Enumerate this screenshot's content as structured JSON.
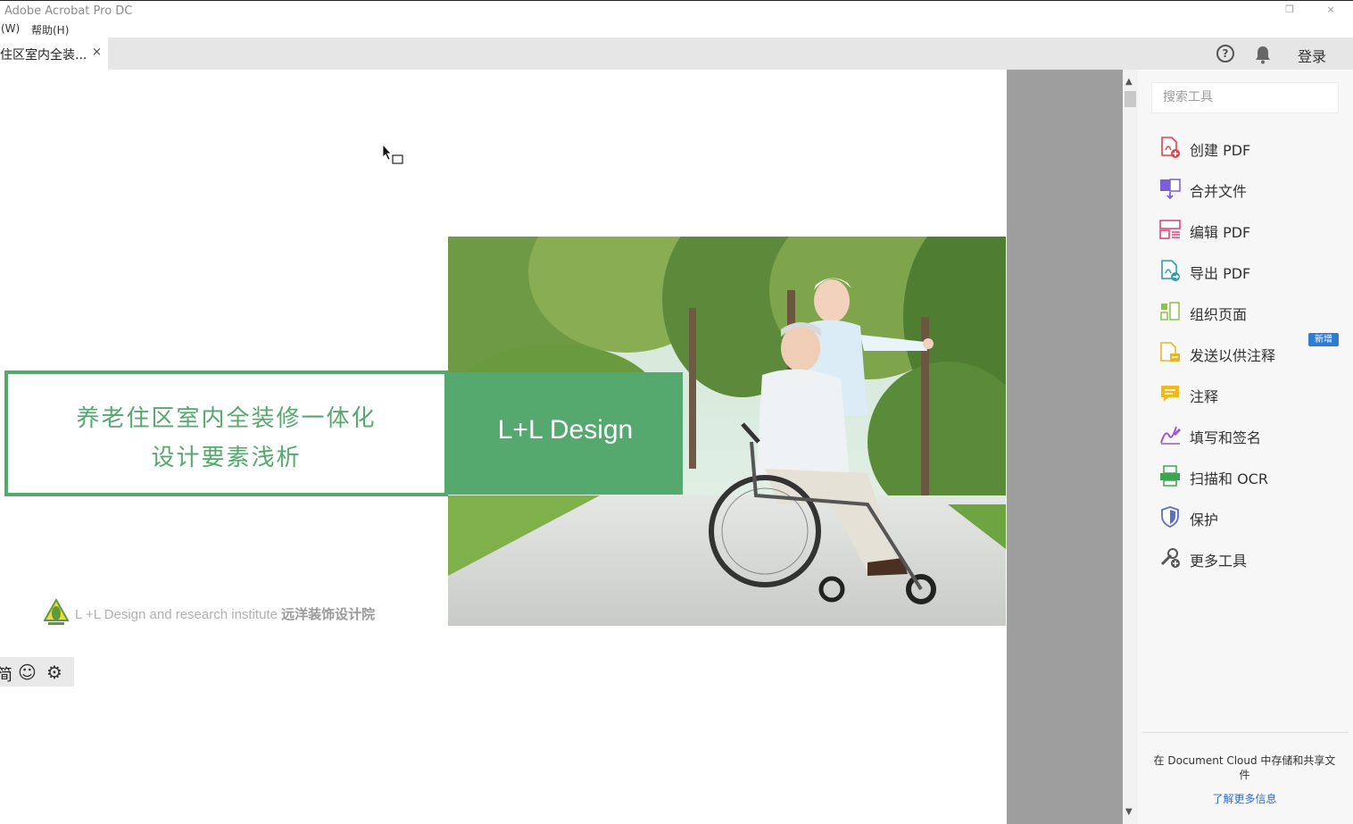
{
  "window": {
    "app_title": "Adobe Acrobat Pro DC",
    "restore_glyph": "❐",
    "close_glyph": "×"
  },
  "menubar": {
    "items": [
      "(W)",
      "帮助(H)"
    ]
  },
  "tabbar": {
    "doc_tab_label": "住区室内全装...",
    "doc_tab_close": "×",
    "help_glyph": "?",
    "signin_label": "登录"
  },
  "document": {
    "title_line1": "养老住区室内全装修一体化",
    "title_line2": "设计要素浅析",
    "brand_box_text": "L+L Design",
    "footer_prefix": "L +L Design and research institute",
    "footer_cn": "远洋装饰设计院",
    "accent_color": "#55a86e"
  },
  "ime": {
    "char": "简",
    "emoji_glyph": "☺",
    "gear_glyph": "⚙"
  },
  "right_panel": {
    "search_placeholder": "搜索工具",
    "tools": [
      {
        "label": "创建 PDF",
        "icon": "create-pdf-icon"
      },
      {
        "label": "合并文件",
        "icon": "combine-files-icon"
      },
      {
        "label": "编辑 PDF",
        "icon": "edit-pdf-icon"
      },
      {
        "label": "导出 PDF",
        "icon": "export-pdf-icon"
      },
      {
        "label": "组织页面",
        "icon": "organize-pages-icon"
      },
      {
        "label": "发送以供注释",
        "icon": "send-for-comments-icon"
      },
      {
        "label": "注释",
        "icon": "comment-icon"
      },
      {
        "label": "填写和签名",
        "icon": "fill-sign-icon"
      },
      {
        "label": "扫描和 OCR",
        "icon": "scan-ocr-icon"
      },
      {
        "label": "保护",
        "icon": "protect-icon"
      },
      {
        "label": "更多工具",
        "icon": "more-tools-icon"
      }
    ],
    "new_badge": "新增",
    "cloud_text": "在 Document Cloud 中存储和共享文件",
    "learn_more": "了解更多信息"
  }
}
